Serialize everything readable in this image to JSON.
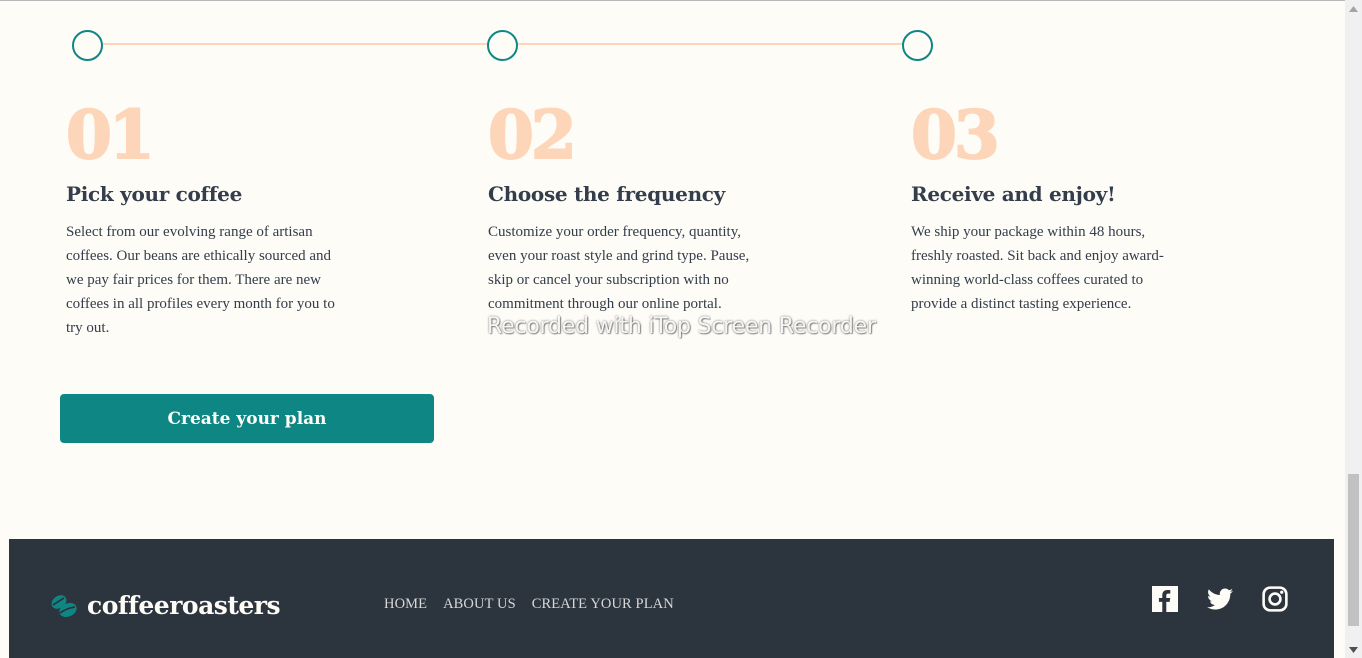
{
  "steps": [
    {
      "number": "01",
      "title": "Pick your coffee",
      "text": "Select from our evolving range of artisan coffees. Our beans are ethically sourced and we pay fair prices for them. There are new coffees in all profiles every month for you to try out."
    },
    {
      "number": "02",
      "title": "Choose the frequency",
      "text": "Customize your order frequency, quantity, even your roast style and grind type. Pause, skip or cancel your subscription with no commitment through our online portal."
    },
    {
      "number": "03",
      "title": "Receive and enjoy!",
      "text": "We ship your package within 48 hours, freshly roasted. Sit back and enjoy award-winning world-class coffees curated to provide a distinct tasting experience."
    }
  ],
  "cta": {
    "label": "Create your plan"
  },
  "watermark": "Recorded with iTop Screen Recorder",
  "footer": {
    "logo_text": "coffeeroasters",
    "nav": [
      "HOME",
      "ABOUT US",
      "CREATE YOUR PLAN"
    ],
    "social_icons": [
      "facebook-icon",
      "twitter-icon",
      "instagram-icon"
    ]
  },
  "colors": {
    "background": "#FEFCF7",
    "accent": "#0E8784",
    "step_number": "#FDD6BA",
    "text": "#333D4B",
    "footer_bg": "#2C343E"
  }
}
